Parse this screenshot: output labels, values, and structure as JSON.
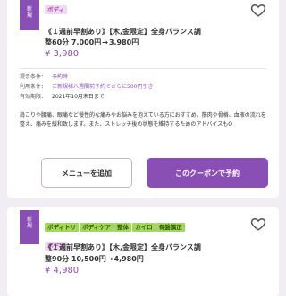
{
  "colors": {
    "accent": "#8a4fb4",
    "tag_bg": "#a5d65f",
    "tag_sub_bg": "#f2d9f3",
    "background": "#f1eef3"
  },
  "card1": {
    "badge": "新規",
    "tags": [],
    "sub_tag": "ボディ",
    "title": "《１週前早割あり》【木,金限定】全身バランス調",
    "price_line": {
      "before": "整60分 7,000円",
      "arrow": "→",
      "after": "3,980円"
    },
    "price": "¥ 3,980",
    "conditions": [
      {
        "label": "提示条件：",
        "value": "予約時",
        "style": "accent"
      },
      {
        "label": "利用条件：",
        "value": "ご新規様八週間前予約でさらに500円引き",
        "style": "accent"
      },
      {
        "label": "有効期限：",
        "value": "2021年10月末日まで",
        "style": "plain"
      }
    ],
    "description": "肩こりや腰痛、眼痛など慢性的な痛みやお悩みを抱えている方におすすめ。筋肉や骨格、血液の流れを整え、痛みを緩和致します。また、ストレッチ後の状態を維持するためのアドバイスもO",
    "menu_button": "メニューを追加",
    "coupon_button": "このクーポンで予約",
    "fav_icon": "heart-icon"
  },
  "card2": {
    "badge": "新規",
    "tags": [
      "ボディトリ",
      "ボディケア",
      "整体",
      "カイロ",
      "骨盤矯正"
    ],
    "sub_tag": "ボディ",
    "title": "《１週前早割あり》【木,金限定】全身バランス調",
    "price_line": {
      "before": "整90分 10,500円",
      "arrow": "→",
      "after": "4,980円"
    },
    "price": "¥ 4,980",
    "fav_icon": "heart-icon"
  }
}
